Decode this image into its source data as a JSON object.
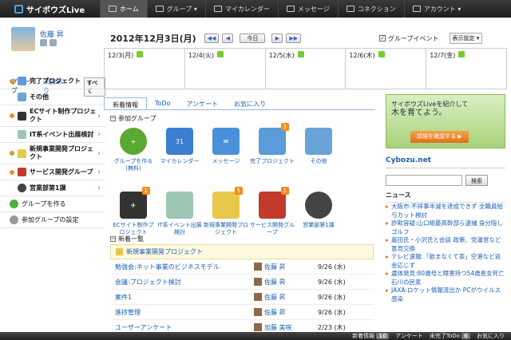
{
  "app": {
    "logo": "サイボウズLive"
  },
  "nav": [
    {
      "label": "ホーム",
      "icon": "home-icon"
    },
    {
      "label": "グループ ▾",
      "icon": "group-icon"
    },
    {
      "label": "マイカレンダー",
      "icon": "calendar-icon"
    },
    {
      "label": "メッセージ",
      "icon": "mail-icon"
    },
    {
      "label": "コネクション",
      "icon": "at-icon"
    },
    {
      "label": "アカウント ▾",
      "icon": "account-icon"
    }
  ],
  "profile": {
    "name": "佐藤 昇"
  },
  "group_tabs": {
    "label": "グループ",
    "unread": "未読あり",
    "all": "すべて"
  },
  "sidebar": [
    {
      "label": "完了プロジェクト"
    },
    {
      "label": "その他"
    },
    {
      "label": "ECサイト制作プロジェクト"
    },
    {
      "label": "IT系イベント出展検討"
    },
    {
      "label": "新規事業開発プロジェクト"
    },
    {
      "label": "サービス開発グループ"
    },
    {
      "label": "営業部第1課"
    },
    {
      "label": "グループを作る"
    },
    {
      "label": "参加グループの設定"
    }
  ],
  "calendar": {
    "date": "2012年12月3日(月)",
    "today": "今日",
    "group_event": "グループイベント",
    "view_select": "表示設定 ▾",
    "days": [
      "12/3(月)",
      "12/4(火)",
      "12/5(水)",
      "12/6(木)",
      "12/7(金)"
    ]
  },
  "tabs": [
    "新着情報",
    "ToDo",
    "アンケート",
    "お気に入り"
  ],
  "groups_section": {
    "title": "参加グループ"
  },
  "groups": [
    {
      "label": "グループを作る(無料)",
      "badge": "",
      "color": "#5aa832"
    },
    {
      "label": "マイカレンダー",
      "badge": "",
      "color": "#3a7fd0"
    },
    {
      "label": "メッセージ",
      "badge": "",
      "color": "#4a90d8"
    },
    {
      "label": "完了プロジェクト",
      "badge": "3",
      "color": "#5b9bd9"
    },
    {
      "label": "その他",
      "badge": "",
      "color": "#6aa3d8"
    },
    {
      "label": "ECサイト制作プロジェクト",
      "badge": "1",
      "color": "#333333"
    },
    {
      "label": "IT系イベント出展検討",
      "badge": "",
      "color": "#9cc7b5"
    },
    {
      "label": "新規事業開発プロジェクト",
      "badge": "5",
      "color": "#e8c84a"
    },
    {
      "label": "サービス開発グループ",
      "badge": "1",
      "color": "#c23b2a"
    },
    {
      "label": "営業部第1課",
      "badge": "",
      "color": "#444444"
    }
  ],
  "updates_section": {
    "title": "新着一覧"
  },
  "updates": {
    "group": "新規事業開発プロジェクト",
    "rows": [
      {
        "title": "勉強会:ネット事業のビジネスモデル",
        "author": "佐藤 昇",
        "date": "9/26 (水)"
      },
      {
        "title": "会議:プロジェクト検討",
        "author": "佐藤 昇",
        "date": "9/26 (水)"
      },
      {
        "title": "案件1",
        "author": "佐藤 昇",
        "date": "9/26 (水)"
      },
      {
        "title": "進捗管理",
        "author": "佐藤 昇",
        "date": "9/26 (水)"
      },
      {
        "title": "ユーザーアンケート",
        "author": "加藤 美咲",
        "date": "2/23 (木)"
      }
    ]
  },
  "ad": {
    "line1": "サイボウズLiveを紹介して",
    "line2": "木を育てよう。",
    "button": "詳細を確認する ▶"
  },
  "cybozu": {
    "title": "Cybozu.net",
    "search": "検索",
    "news_title": "ニュース"
  },
  "news": [
    "大阪市:不祥事半減を達成できず 全職員給与カット検討",
    "詐欺容疑:山口組最高幹部ら逮捕 身分隠しゴルフ",
    "嘉田氏・小沢氏と会談 政策、党運営など意見交換",
    "テレビ速報:「飲まなくて茶」空港など返金応じず",
    "遺体発見:80歳母と障害持つ54歳長女死亡 石川の民家",
    "JAXA:ロケット情報流出か PCがウイルス感染"
  ],
  "statusbar": {
    "updates": "新着情報",
    "updates_count": "10",
    "survey": "アンケート",
    "todo": "未完了ToDo",
    "todo_count": "6",
    "fav": "お気に入り"
  }
}
